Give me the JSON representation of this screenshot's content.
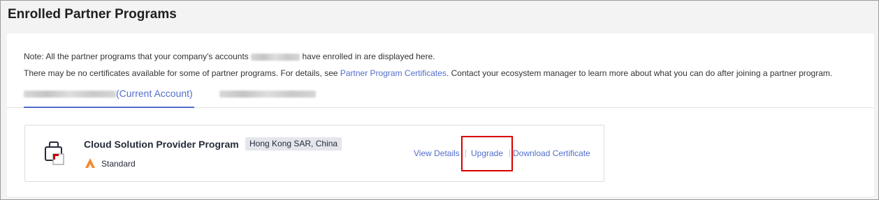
{
  "page": {
    "title": "Enrolled Partner Programs"
  },
  "note": {
    "line1_prefix": "Note: All the partner programs that your company's accounts",
    "line1_suffix": " have enrolled in are displayed here.",
    "line2_prefix": "There may be no certificates available for some of partner programs. For details, see ",
    "line2_link": "Partner Program Certificates",
    "line2_suffix": ". Contact your ecosystem manager to learn more about what you can do after joining a partner program."
  },
  "tabs": [
    {
      "label": "(Current Account)",
      "active": true
    },
    {
      "label": "",
      "active": false
    }
  ],
  "program": {
    "name": "Cloud Solution Provider Program",
    "region": "Hong Kong SAR, China",
    "level": "Standard",
    "icon": "briefcase-icon",
    "level_icon": "triangle-level-icon",
    "actions": {
      "view_details": "View Details",
      "upgrade": "Upgrade",
      "download": "Download Certificate"
    }
  },
  "colors": {
    "link": "#526ecc",
    "highlight": "#d40000",
    "level": "#f08a2c",
    "icon_accent": "#c7000b"
  }
}
